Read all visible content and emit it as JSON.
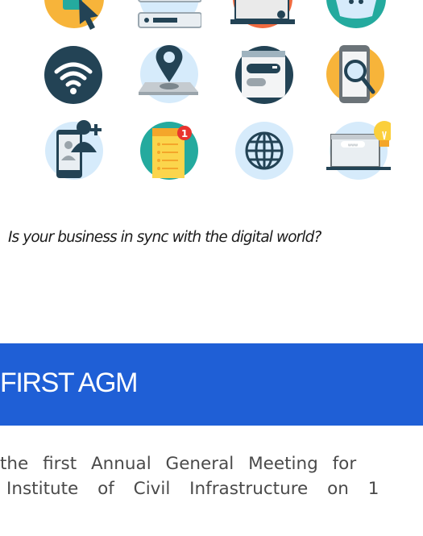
{
  "icons": [
    {
      "name": "cursor-click-icon"
    },
    {
      "name": "server-icon"
    },
    {
      "name": "laptop-icon"
    },
    {
      "name": "gamepad-icon"
    },
    {
      "name": "wifi-icon"
    },
    {
      "name": "map-pin-icon"
    },
    {
      "name": "chat-window-icon"
    },
    {
      "name": "mobile-search-icon"
    },
    {
      "name": "add-user-icon"
    },
    {
      "name": "notes-notification-icon",
      "badge": "1"
    },
    {
      "name": "globe-icon"
    },
    {
      "name": "laptop-idea-icon",
      "url_label": "www"
    }
  ],
  "tagline": "Is your business in sync with the digital  world?",
  "agm": {
    "title": "FIRST AGM",
    "body_line1": "the first Annual General Meeting for",
    "body_line2": "Institute of Civil Infrastructure on 1"
  },
  "colors": {
    "banner": "#1f5fd6",
    "light_blue": "#d6ebfb",
    "navy": "#234355",
    "teal": "#24aa9e",
    "orange": "#ef6a3f",
    "yellow": "#f7b43a"
  }
}
